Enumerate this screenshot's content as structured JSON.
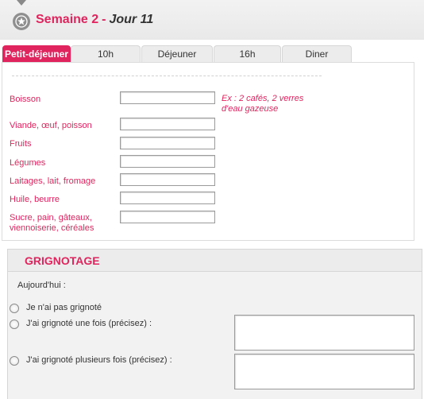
{
  "header": {
    "week": "Semaine 2",
    "separator": "-",
    "day": "Jour 11",
    "icon": "star-icon"
  },
  "tabs": [
    {
      "label": "Petit-déjeuner",
      "active": true
    },
    {
      "label": "10h",
      "active": false
    },
    {
      "label": "Déjeuner",
      "active": false
    },
    {
      "label": "16h",
      "active": false
    },
    {
      "label": "Diner",
      "active": false
    }
  ],
  "meal_form": {
    "hint": "Ex : 2 cafés, 2 verres d'eau gazeuse",
    "fields": [
      {
        "label": "Boisson",
        "value": ""
      },
      {
        "label": "Viande, œuf, poisson",
        "value": ""
      },
      {
        "label": "Fruits",
        "value": ""
      },
      {
        "label": "Légumes",
        "value": ""
      },
      {
        "label": "Laitages, lait, fromage",
        "value": ""
      },
      {
        "label": "Huile, beurre",
        "value": ""
      },
      {
        "label": "Sucre, pain, gâteaux,",
        "label2": "viennoiserie, céréales",
        "value": ""
      }
    ]
  },
  "snack": {
    "title": "GRIGNOTAGE",
    "today_label": "Aujourd'hui :",
    "options": [
      {
        "label": "Je n'ai pas grignoté",
        "checked": false
      },
      {
        "label": "J'ai grignoté une fois (précisez) :",
        "checked": false
      },
      {
        "label": "J'ai grignoté plusieurs fois (précisez) :",
        "checked": false
      }
    ],
    "details_once": "",
    "details_many": ""
  },
  "colors": {
    "accent": "#e0245e",
    "panel_bg": "#f2f2f2",
    "header_bg": "#ececec"
  }
}
